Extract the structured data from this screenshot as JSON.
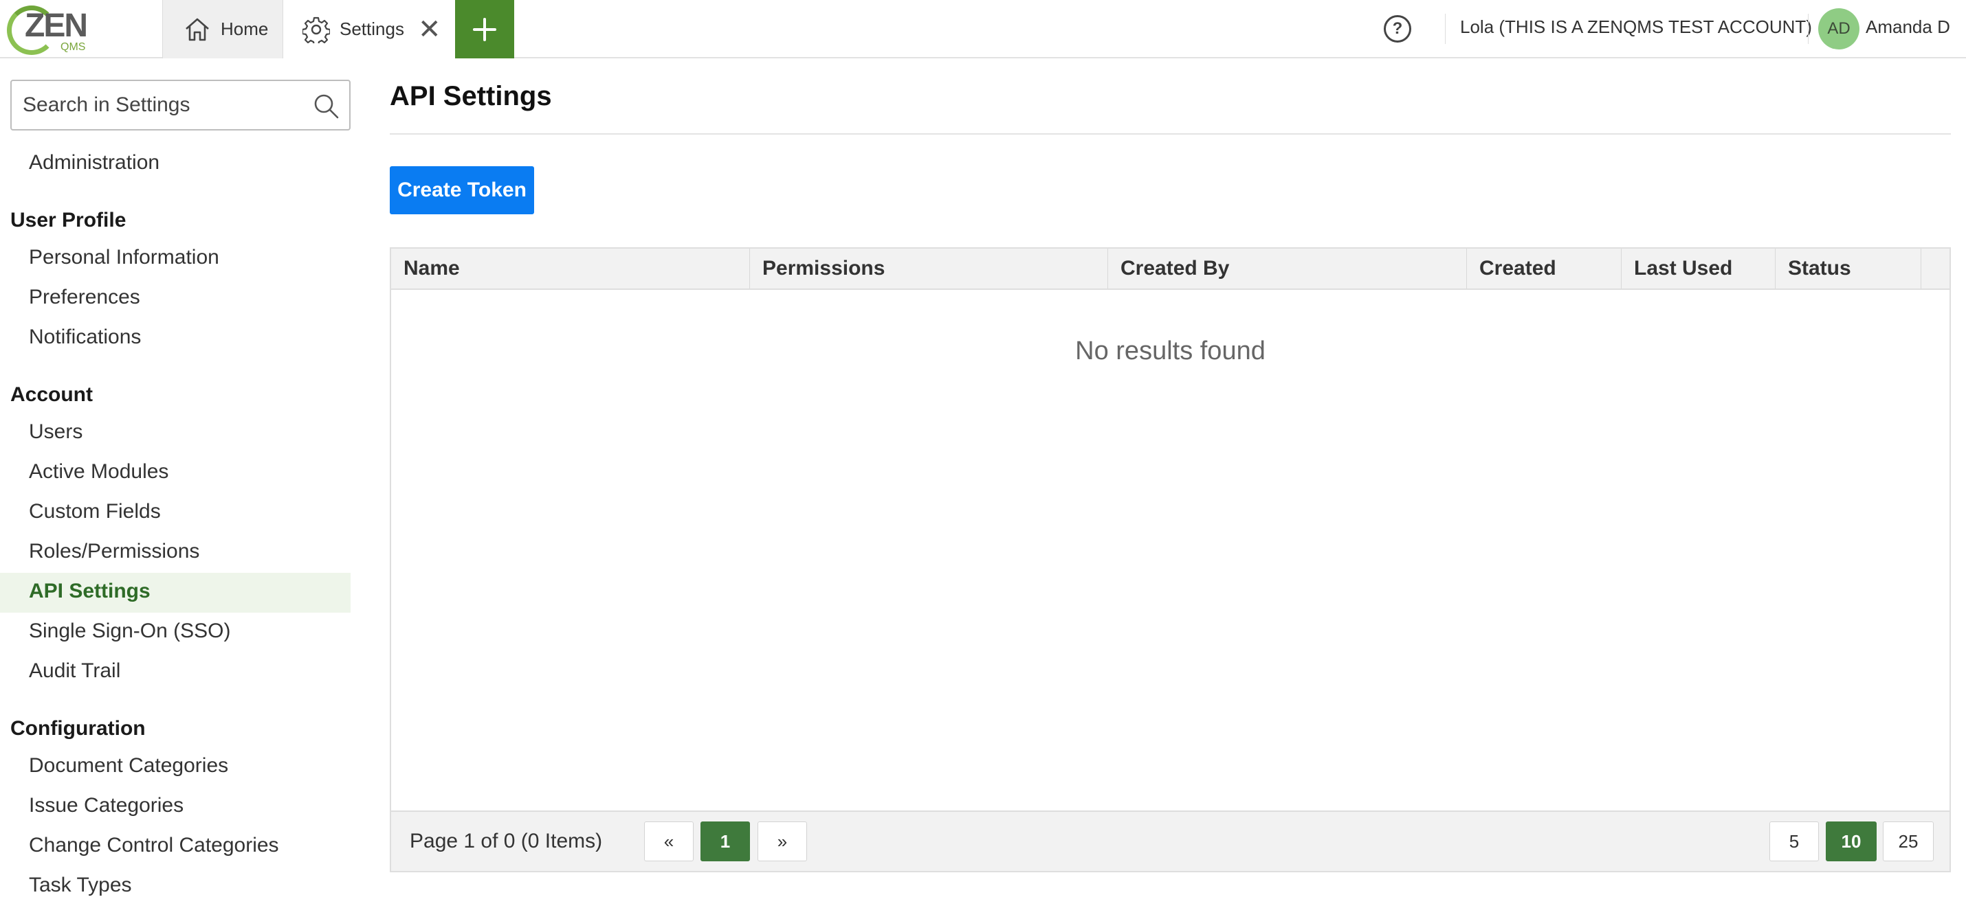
{
  "app": {
    "logo_text": "ZEN",
    "logo_sub": "QMS",
    "brand_green": "#4b8a2c"
  },
  "tabs": {
    "home_label": "Home",
    "settings_label": "Settings",
    "close_glyph": "✕",
    "add_glyph": "+"
  },
  "header": {
    "help_glyph": "?",
    "account_name": "Lola (THIS IS A ZENQMS TEST ACCOUNT)",
    "avatar_initials": "AD",
    "user_name": "Amanda D"
  },
  "sidebar": {
    "search_placeholder": "Search in Settings",
    "top_item": "Administration",
    "sections": [
      {
        "heading": "User Profile",
        "items": [
          "Personal Information",
          "Preferences",
          "Notifications"
        ]
      },
      {
        "heading": "Account",
        "items": [
          "Users",
          "Active Modules",
          "Custom Fields",
          "Roles/Permissions",
          "API Settings",
          "Single Sign-On (SSO)",
          "Audit Trail"
        ]
      },
      {
        "heading": "Configuration",
        "items": [
          "Document Categories",
          "Issue Categories",
          "Change Control Categories",
          "Task Types"
        ]
      }
    ],
    "active_item": "API Settings"
  },
  "main": {
    "title": "API Settings",
    "create_button": "Create Token",
    "columns": [
      "Name",
      "Permissions",
      "Created By",
      "Created",
      "Last Used",
      "Status"
    ],
    "empty_text": "No results found",
    "pagination": {
      "info": "Page 1 of 0 (0 Items)",
      "prev": "«",
      "current": "1",
      "next": "»",
      "page_sizes": [
        "5",
        "10",
        "25"
      ],
      "selected_size": "10"
    }
  }
}
